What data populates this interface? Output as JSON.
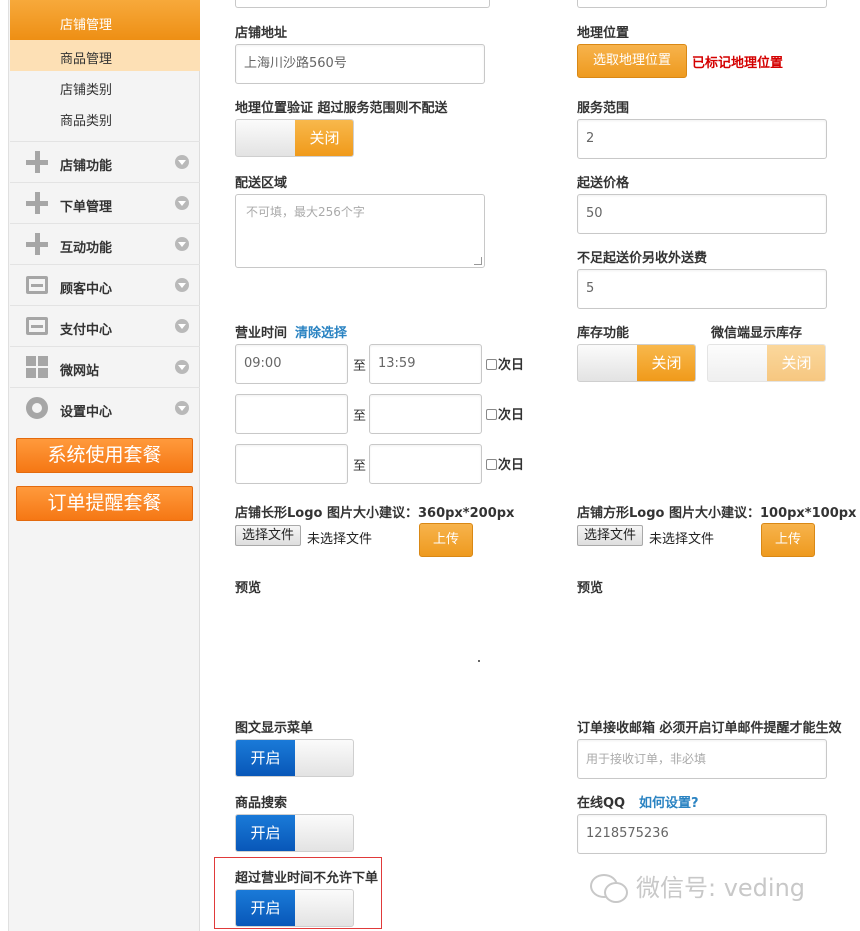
{
  "sidebar": {
    "top_item": "店铺管理",
    "sub_items": [
      "商品管理",
      "店铺类别",
      "商品类别"
    ],
    "items": [
      {
        "label": "店铺功能",
        "icon": "plus-icon"
      },
      {
        "label": "下单管理",
        "icon": "plus-icon"
      },
      {
        "label": "互动功能",
        "icon": "plus-icon"
      },
      {
        "label": "顾客中心",
        "icon": "inbox-icon"
      },
      {
        "label": "支付中心",
        "icon": "inbox-icon"
      },
      {
        "label": "微网站",
        "icon": "grid-icon"
      },
      {
        "label": "设置中心",
        "icon": "gear-icon"
      }
    ],
    "buttons": [
      "系统使用套餐",
      "订单提醒套餐"
    ]
  },
  "form": {
    "address_label": "店铺地址",
    "address_value": "上海川沙路560号",
    "geo_label": "地理位置",
    "geo_button": "选取地理位置",
    "geo_status": "已标记地理位置",
    "geo_verify_label": "地理位置验证 超过服务范围则不配送",
    "geo_verify_toggle": "关闭",
    "service_range_label": "服务范围",
    "service_range_value": "2",
    "delivery_area_label": "配送区域",
    "delivery_area_placeholder": "不可填，最大256个字",
    "min_price_label": "起送价格",
    "min_price_value": "50",
    "extra_fee_label": "不足起送价另收外送费",
    "extra_fee_value": "5",
    "hours_label": "营业时间",
    "hours_clear": "清除选择",
    "hours": [
      {
        "start": "09:00",
        "end": "13:59"
      },
      {
        "start": "",
        "end": ""
      },
      {
        "start": "",
        "end": ""
      }
    ],
    "to_text": "至",
    "next_day": "次日",
    "stock_label": "库存功能",
    "stock_toggle": "关闭",
    "wx_stock_label": "微信端显示库存",
    "wx_stock_toggle": "关闭",
    "logo_long_label": "店铺长形Logo 图片大小建议：360px*200px",
    "logo_square_label": "店铺方形Logo 图片大小建议：100px*100px",
    "choose_file": "选择文件",
    "no_file": "未选择文件",
    "upload": "上传",
    "preview": "预览",
    "menu_label": "图文显示菜单",
    "menu_toggle": "开启",
    "search_label": "商品搜索",
    "search_toggle": "开启",
    "overtime_label": "超过营业时间不允许下单",
    "overtime_toggle": "开启",
    "email_label": "订单接收邮箱  必须开启订单邮件提醒才能生效",
    "email_placeholder": "用于接收订单，非必填",
    "qq_label": "在线QQ",
    "qq_help": "如何设置?",
    "qq_value": "1218575236"
  },
  "watermark": "微信号: veding",
  "colors": {
    "accent": "#f09a1a",
    "blue": "#0a5ec2",
    "red": "#d40000",
    "link": "#2a83c2"
  }
}
